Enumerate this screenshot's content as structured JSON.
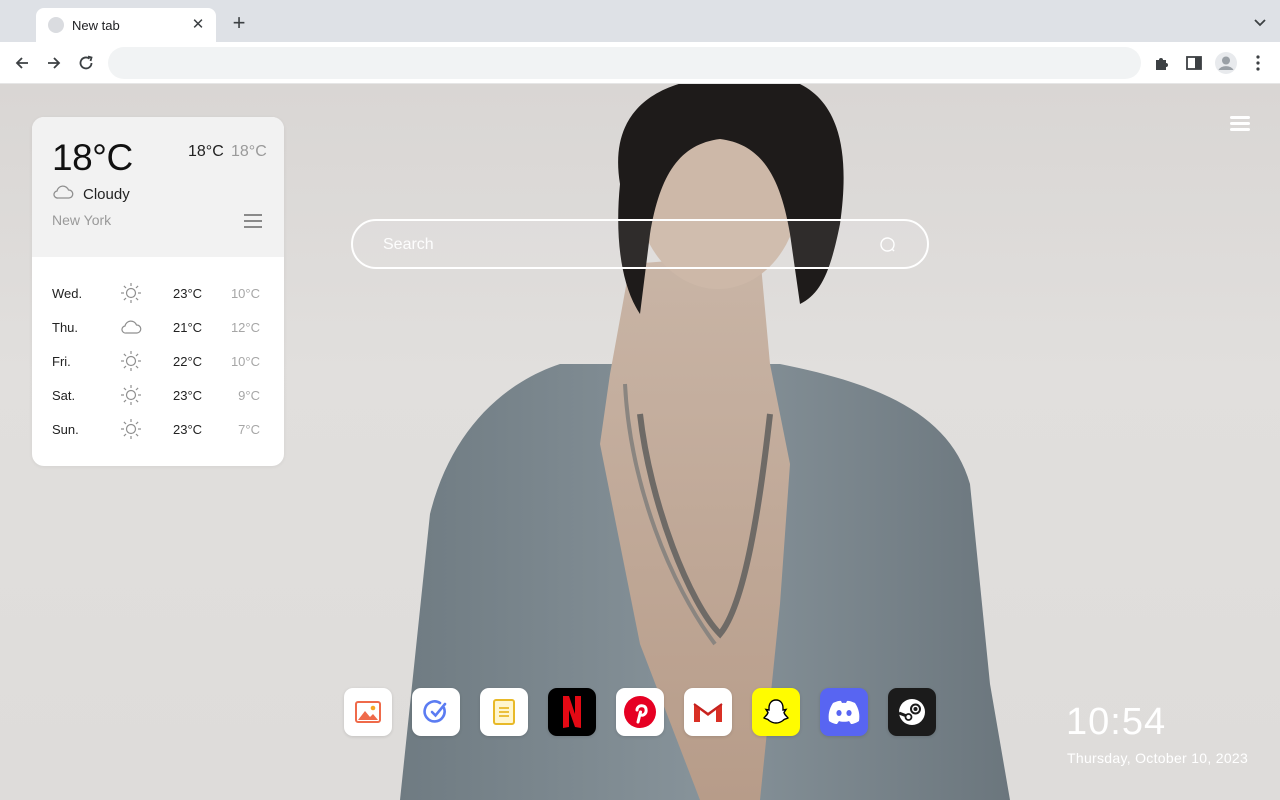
{
  "browser": {
    "tab": {
      "title": "New tab",
      "close_glyph": "✕"
    },
    "new_tab_glyph": "+",
    "omnibox": {
      "value": "",
      "placeholder": ""
    }
  },
  "weather": {
    "current_temp": "18°C",
    "high": "18°C",
    "low": "18°C",
    "condition": "Cloudy",
    "condition_icon": "cloud-icon",
    "city": "New York",
    "forecast": [
      {
        "day": "Wed.",
        "icon": "sun-icon",
        "high": "23°C",
        "low": "10°C"
      },
      {
        "day": "Thu.",
        "icon": "cloud-icon",
        "high": "21°C",
        "low": "12°C"
      },
      {
        "day": "Fri.",
        "icon": "sun-icon",
        "high": "22°C",
        "low": "10°C"
      },
      {
        "day": "Sat.",
        "icon": "sun-icon",
        "high": "23°C",
        "low": "9°C"
      },
      {
        "day": "Sun.",
        "icon": "sun-icon",
        "high": "23°C",
        "low": "7°C"
      }
    ]
  },
  "search": {
    "placeholder": "Search"
  },
  "dock": {
    "apps": [
      {
        "name": "photos",
        "icon": "image-icon"
      },
      {
        "name": "tasks",
        "icon": "check-circle-icon"
      },
      {
        "name": "notes",
        "icon": "note-icon"
      },
      {
        "name": "Netflix",
        "icon": "netflix-icon"
      },
      {
        "name": "Pinterest",
        "icon": "pinterest-icon"
      },
      {
        "name": "Gmail",
        "icon": "gmail-icon"
      },
      {
        "name": "Snapchat",
        "icon": "snapchat-icon"
      },
      {
        "name": "Discord",
        "icon": "discord-icon"
      },
      {
        "name": "Steam",
        "icon": "steam-icon"
      }
    ]
  },
  "clock": {
    "time": "10:54",
    "date": "Thursday, October 10, 2023"
  },
  "colors": {
    "netflix": "#000000",
    "netflix_red": "#e50914",
    "pinterest": "#e60023",
    "snapchat": "#fffc00",
    "discord": "#5865f2",
    "steam": "#1b1b1b"
  }
}
